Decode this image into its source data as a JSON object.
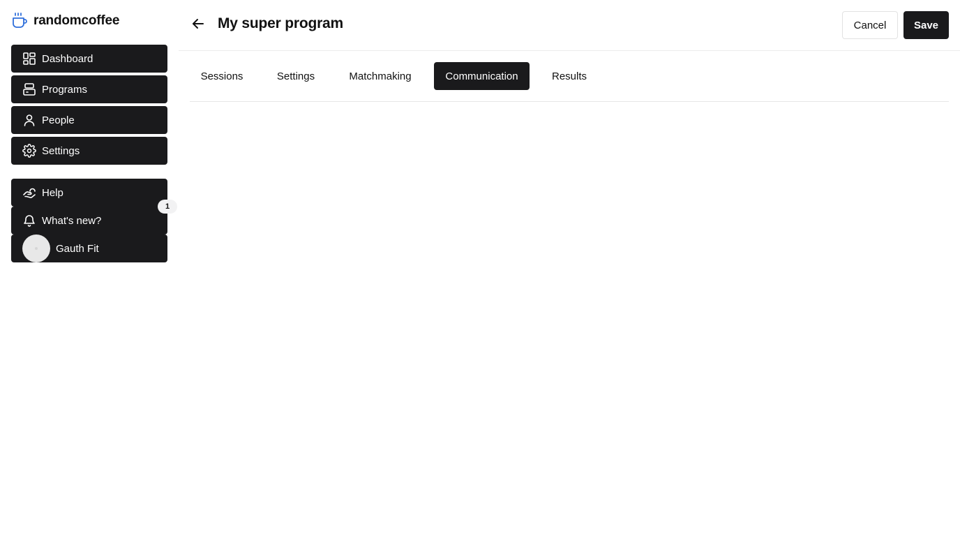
{
  "brand": {
    "name": "randomcoffee",
    "icon": "coffee-cup-icon",
    "accent": "#2f6fdb"
  },
  "sidebar": {
    "items": [
      {
        "label": "Dashboard",
        "icon": "dashboard-icon"
      },
      {
        "label": "Programs",
        "icon": "programs-icon"
      },
      {
        "label": "People",
        "icon": "person-icon"
      },
      {
        "label": "Settings",
        "icon": "gear-icon"
      }
    ],
    "secondary": [
      {
        "label": "Help",
        "icon": "help-hand-icon"
      },
      {
        "label": "What's new?",
        "icon": "bell-icon",
        "badge": "1"
      }
    ],
    "user": {
      "name": "Gauth Fit"
    }
  },
  "header": {
    "title": "My super program",
    "cancel_label": "Cancel",
    "save_label": "Save"
  },
  "tabs": [
    {
      "label": "Sessions",
      "active": false
    },
    {
      "label": "Settings",
      "active": false
    },
    {
      "label": "Matchmaking",
      "active": false
    },
    {
      "label": "Communication",
      "active": true
    },
    {
      "label": "Results",
      "active": false
    }
  ],
  "colors": {
    "dark": "#1a1a1c",
    "border": "#e6e6e6",
    "badge_bg": "#f2f2f3"
  }
}
